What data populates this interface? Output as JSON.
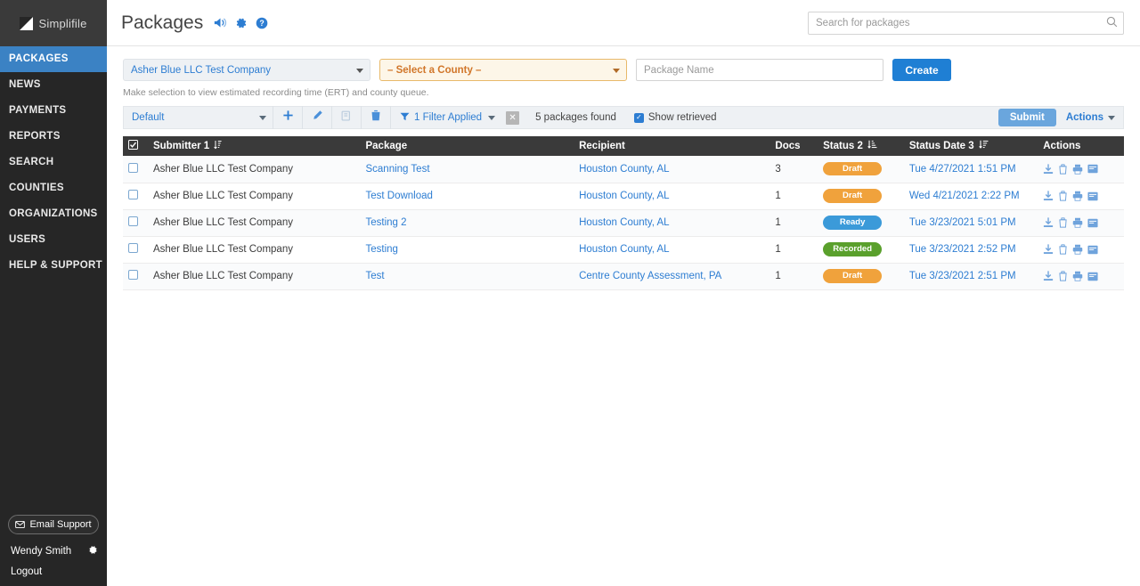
{
  "brand": {
    "name": "Simplifile",
    "logo_icon": "simplifile-logo-icon"
  },
  "sidebar": {
    "items": [
      {
        "label": "PACKAGES",
        "active": true
      },
      {
        "label": "NEWS",
        "active": false
      },
      {
        "label": "PAYMENTS",
        "active": false
      },
      {
        "label": "REPORTS",
        "active": false
      },
      {
        "label": "SEARCH",
        "active": false
      },
      {
        "label": "COUNTIES",
        "active": false
      },
      {
        "label": "ORGANIZATIONS",
        "active": false
      },
      {
        "label": "USERS",
        "active": false
      },
      {
        "label": "HELP & SUPPORT",
        "active": false
      }
    ],
    "email_support_label": "Email Support",
    "email_support_icon": "envelope-icon",
    "user_name": "Wendy Smith",
    "user_settings_icon": "gear-icon",
    "logout_label": "Logout"
  },
  "header": {
    "title": "Packages",
    "icons": [
      "announcement-icon",
      "gear-icon",
      "help-icon"
    ],
    "search_placeholder": "Search for packages",
    "search_value": "",
    "search_icon": "search-icon"
  },
  "selection_bar": {
    "company_value": "Asher Blue LLC Test Company",
    "county_value": "– Select a County –",
    "package_name_placeholder": "Package Name",
    "package_name_value": "",
    "create_label": "Create",
    "hint": "Make selection to view estimated recording time (ERT) and county queue."
  },
  "toolbar": {
    "view_value": "Default",
    "add_icon": "plus-icon",
    "edit_icon": "pencil-icon",
    "copy_icon": "copy-icon",
    "delete_icon": "trash-icon",
    "filter_icon": "filter-icon",
    "filter_label": "1 Filter Applied",
    "clear_filter_icon": "close-icon",
    "clear_filter_glyph": "✕",
    "count_label": "5 packages found",
    "show_retrieved_label": "Show retrieved",
    "show_retrieved_checked": true,
    "submit_label": "Submit",
    "actions_label": "Actions"
  },
  "table": {
    "columns": [
      {
        "key": "select",
        "label": "",
        "sortable": false
      },
      {
        "key": "submitter",
        "label": "Submitter 1",
        "sortable": true
      },
      {
        "key": "package",
        "label": "Package",
        "sortable": false
      },
      {
        "key": "recipient",
        "label": "Recipient",
        "sortable": false
      },
      {
        "key": "docs",
        "label": "Docs",
        "sortable": false
      },
      {
        "key": "status",
        "label": "Status 2",
        "sortable": true
      },
      {
        "key": "status_date",
        "label": "Status Date 3",
        "sortable": true
      },
      {
        "key": "actions",
        "label": "Actions",
        "sortable": false
      }
    ],
    "header_select_all_checked": true,
    "row_action_icons": [
      "download-icon",
      "trash-icon",
      "print-icon",
      "archive-icon"
    ],
    "status_colors": {
      "Draft": "#f0a23c",
      "Ready": "#3b9ad9",
      "Recorded": "#5aa02c"
    },
    "rows": [
      {
        "selected": false,
        "submitter": "Asher Blue LLC Test Company",
        "package": "Scanning Test",
        "recipient": "Houston County, AL",
        "docs": "3",
        "status": "Draft",
        "status_date": "Tue 4/27/2021 1:51 PM"
      },
      {
        "selected": false,
        "submitter": "Asher Blue LLC Test Company",
        "package": "Test Download",
        "recipient": "Houston County, AL",
        "docs": "1",
        "status": "Draft",
        "status_date": "Wed 4/21/2021 2:22 PM"
      },
      {
        "selected": false,
        "submitter": "Asher Blue LLC Test Company",
        "package": "Testing 2",
        "recipient": "Houston County, AL",
        "docs": "1",
        "status": "Ready",
        "status_date": "Tue 3/23/2021 5:01 PM"
      },
      {
        "selected": false,
        "submitter": "Asher Blue LLC Test Company",
        "package": "Testing",
        "recipient": "Houston County, AL",
        "docs": "1",
        "status": "Recorded",
        "status_date": "Tue 3/23/2021 2:52 PM"
      },
      {
        "selected": false,
        "submitter": "Asher Blue LLC Test Company",
        "package": "Test",
        "recipient": "Centre County Assessment, PA",
        "docs": "1",
        "status": "Draft",
        "status_date": "Tue 3/23/2021 2:51 PM"
      }
    ]
  },
  "colors": {
    "accent_blue": "#2d7dd2",
    "sidebar_bg": "#262626",
    "sidebar_active": "#3b82c4",
    "header_row_bg": "#3a3a3a",
    "create_button": "#1f7fd4",
    "county_border": "#e8b96a"
  }
}
